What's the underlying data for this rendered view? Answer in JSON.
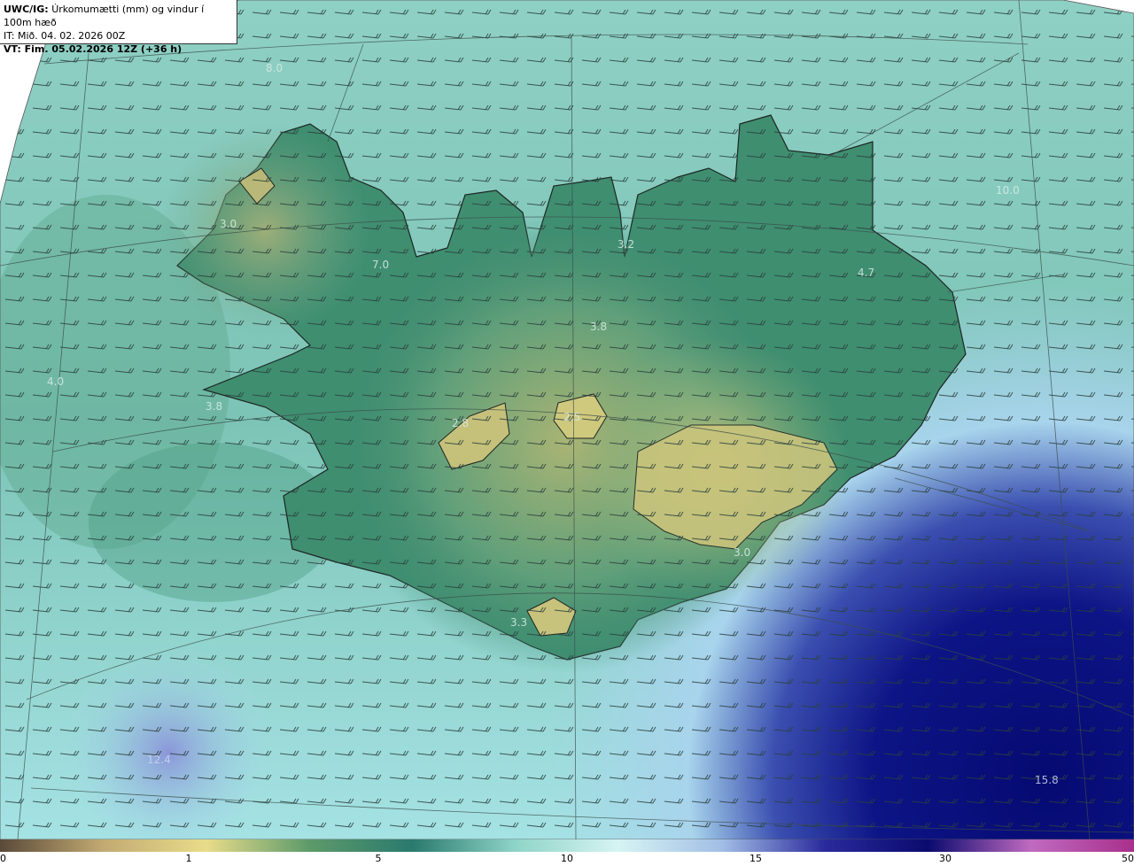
{
  "header": {
    "model": "UWC/IG:",
    "parameter": "Úrkomumætti (mm) og vindur í 100m hæð",
    "issue_time": "IT: Mið. 04. 02. 2026 00Z",
    "valid_time": "VT: Fim. 05.02.2026 12Z (+36 h)"
  },
  "map": {
    "field_labels": [
      {
        "name": "value-label-northwest-sea",
        "text": "8.0"
      },
      {
        "name": "value-label-westfjords",
        "text": "3.0"
      },
      {
        "name": "value-label-westfjords-coast",
        "text": "7.0"
      },
      {
        "name": "value-label-west-sea",
        "text": "4.0"
      },
      {
        "name": "value-label-snaefellsnes",
        "text": "3.8"
      },
      {
        "name": "value-label-langjokull",
        "text": "2.8"
      },
      {
        "name": "value-label-hofsjokull",
        "text": "2.5"
      },
      {
        "name": "value-label-north",
        "text": "3.8"
      },
      {
        "name": "value-label-trollaskagi",
        "text": "3.2"
      },
      {
        "name": "value-label-east",
        "text": "4.7"
      },
      {
        "name": "value-label-northeast-sea",
        "text": "10.0"
      },
      {
        "name": "value-label-vatnajokull-south",
        "text": "3.0"
      },
      {
        "name": "value-label-myrdalsjokull",
        "text": "3.3"
      },
      {
        "name": "value-label-southwest-sea",
        "text": "12.4"
      },
      {
        "name": "value-label-southeast-sea",
        "text": "15.8"
      }
    ]
  },
  "colorbar": {
    "ticks": [
      "0",
      "1",
      "5",
      "10",
      "15",
      "30",
      "50"
    ],
    "colors": [
      "#5a4a3a",
      "#c2aa72",
      "#e8dc8a",
      "#5d9a6a",
      "#2a7a6e",
      "#8fd4c8",
      "#d6f4f4",
      "#a2bee6",
      "#2a2a9c",
      "#0a0a6e",
      "#c06ac0",
      "#a8308c"
    ]
  }
}
